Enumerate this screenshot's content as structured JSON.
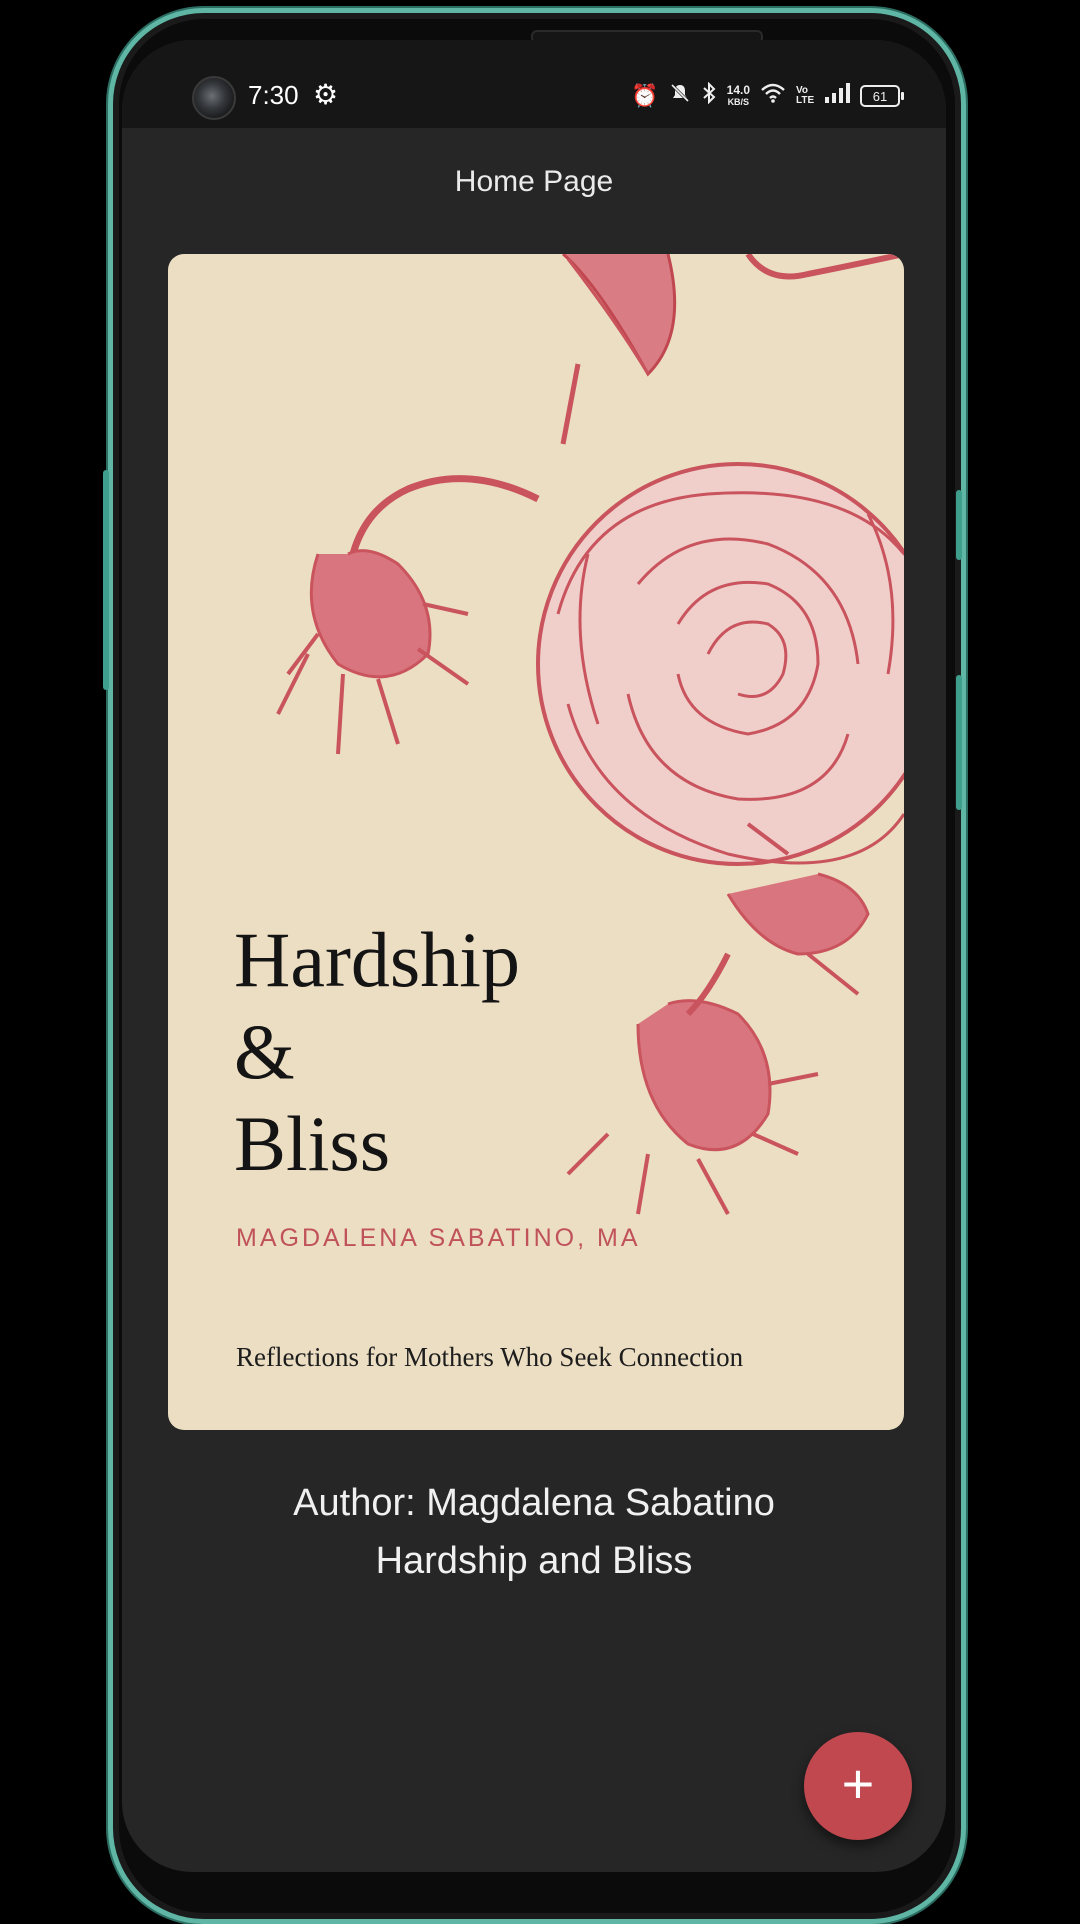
{
  "status_bar": {
    "time": "7:30",
    "net_speed_value": "14.0",
    "net_speed_unit": "KB/S",
    "volte": "Vo LTE",
    "battery": "61",
    "icons": [
      "gear-icon",
      "alarm-icon",
      "bell-off-icon",
      "bluetooth-icon",
      "wifi-icon",
      "signal-icon",
      "battery-icon"
    ]
  },
  "header": {
    "title": "Home Page"
  },
  "book_cover": {
    "title_line1": "Hardship",
    "title_line2": "&",
    "title_line3": "Bliss",
    "author": "MAGDALENA SABATINO, MA",
    "subtitle": "Reflections for Mothers Who Seek Connection",
    "colors": {
      "background": "#ecdec3",
      "illustration": "#c9545e"
    }
  },
  "book_meta": {
    "author_line": "Author: Magdalena Sabatino",
    "title_line": "Hardship and Bliss"
  },
  "fab": {
    "label": "+",
    "color": "#c0484e"
  }
}
